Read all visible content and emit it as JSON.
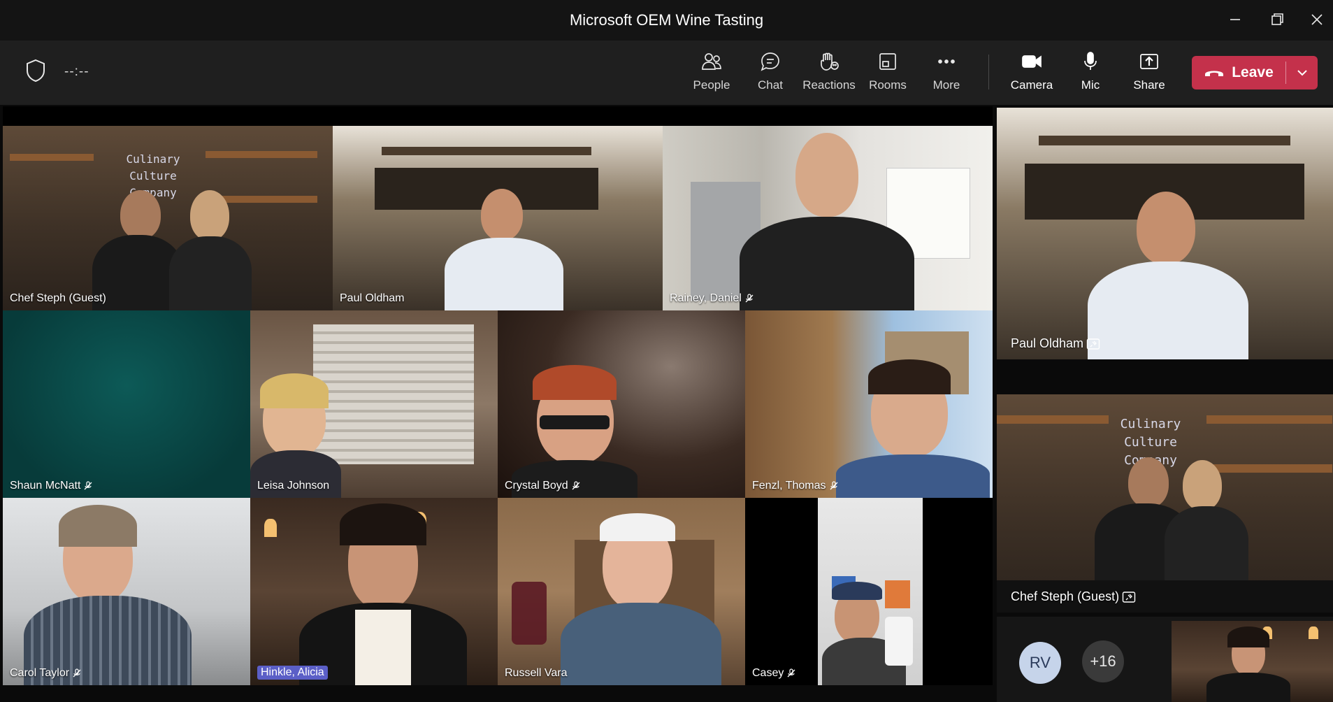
{
  "window": {
    "title": "Microsoft OEM Wine Tasting"
  },
  "toolbar": {
    "timer": "--:--",
    "buttons": [
      {
        "label": "People",
        "icon": "people-icon"
      },
      {
        "label": "Chat",
        "icon": "chat-icon"
      },
      {
        "label": "Reactions",
        "icon": "reactions-icon"
      },
      {
        "label": "Rooms",
        "icon": "rooms-icon"
      },
      {
        "label": "More",
        "icon": "more-icon"
      },
      {
        "label": "Camera",
        "icon": "camera-icon"
      },
      {
        "label": "Mic",
        "icon": "mic-icon"
      },
      {
        "label": "Share",
        "icon": "share-icon"
      }
    ],
    "leave_label": "Leave",
    "leave_color": "#c4314b"
  },
  "gallery": [
    {
      "name": "Chef Steph (Guest)",
      "muted": false
    },
    {
      "name": "Paul Oldham",
      "muted": false
    },
    {
      "name": "Rainey, Daniel",
      "muted": true
    },
    {
      "name": "Shaun McNatt",
      "muted": true
    },
    {
      "name": "Leisa Johnson",
      "muted": false
    },
    {
      "name": "Crystal Boyd",
      "muted": true
    },
    {
      "name": "Fenzl, Thomas",
      "muted": true
    },
    {
      "name": "Carol Taylor",
      "muted": true
    },
    {
      "name": "Hinkle, Alicia",
      "muted": false,
      "highlighted": true
    },
    {
      "name": "Russell Vara",
      "muted": false
    },
    {
      "name": "Casey",
      "muted": true
    }
  ],
  "sidebar": {
    "pinned": [
      {
        "name": "Paul Oldham",
        "icon": "pinned-icon"
      },
      {
        "name": "Chef Steph (Guest)",
        "icon": "pinned-icon"
      }
    ],
    "avatar_initials": "RV",
    "overflow_count": "+16"
  }
}
